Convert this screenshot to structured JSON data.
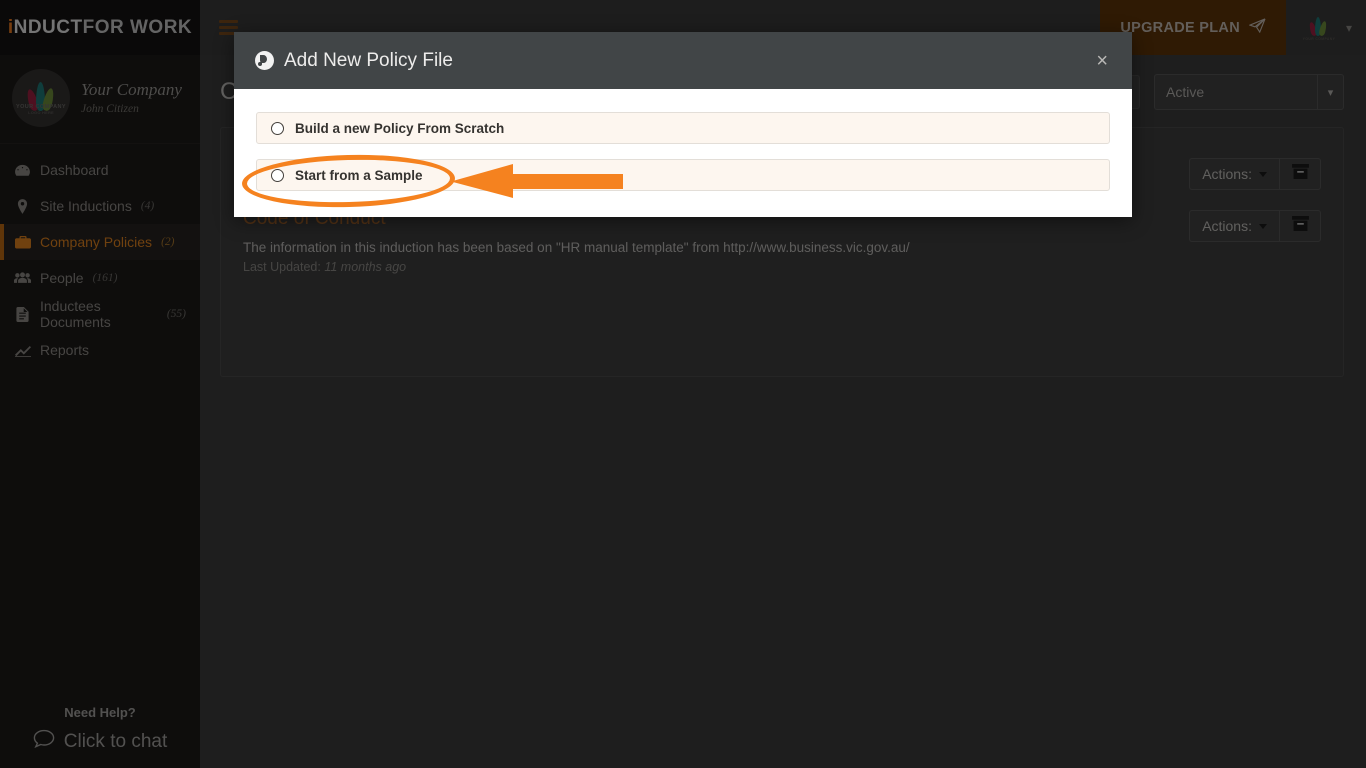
{
  "sidebar": {
    "brand": {
      "part1": "i",
      "part2": "NDUCT",
      "part3": "FOR WORK"
    },
    "company": {
      "name": "Your Company",
      "user": "John Citizen",
      "logo_caption": "YOUR COMPANY",
      "logo_subcaption": "LOGO HERE"
    },
    "items": [
      {
        "label": "Dashboard",
        "count": "",
        "icon": "dashboard-icon"
      },
      {
        "label": "Site Inductions",
        "count": "(4)",
        "icon": "map-pin-icon"
      },
      {
        "label": "Company Policies",
        "count": "(2)",
        "icon": "briefcase-icon"
      },
      {
        "label": "People",
        "count": "(161)",
        "icon": "people-icon"
      },
      {
        "label": "Inductees Documents",
        "count": "(55)",
        "icon": "document-icon"
      },
      {
        "label": "Reports",
        "count": "",
        "icon": "chart-icon"
      }
    ],
    "help": {
      "title": "Need Help?",
      "chat": "Click to chat"
    }
  },
  "topbar": {
    "upgrade_label": "UPGRADE PLAN",
    "upgrade_icon": "paper-plane-icon",
    "menu_icon": "hamburger-icon",
    "avatar_caption": "YOUR COMPANY",
    "caret_icon": "chevron-down-icon"
  },
  "content": {
    "page_title": "Company Policies",
    "search_placeholder": "",
    "status_value": "Active",
    "status_options": [
      "Active"
    ],
    "policies": [
      {
        "title": "",
        "description": "",
        "updated_label": "",
        "updated_value": "",
        "actions_label": "Actions:",
        "archive_icon": "archive-icon"
      },
      {
        "title": "Code of Conduct",
        "description": "The information in this induction has been based on \"HR manual template\" from http://www.business.vic.gov.au/",
        "updated_label": "Last Updated:",
        "updated_value": "11 months ago",
        "actions_label": "Actions:",
        "archive_icon": "archive-icon"
      }
    ]
  },
  "modal": {
    "title": "Add New Policy File",
    "title_icon": "globe-icon",
    "close_label": "×",
    "options": [
      {
        "label": "Build a new Policy From Scratch"
      },
      {
        "label": "Start from a Sample"
      }
    ]
  },
  "annotations": {
    "highlight_color": "#f5821f",
    "ellipse_target": "Start from a Sample",
    "arrow_direction": "left"
  }
}
